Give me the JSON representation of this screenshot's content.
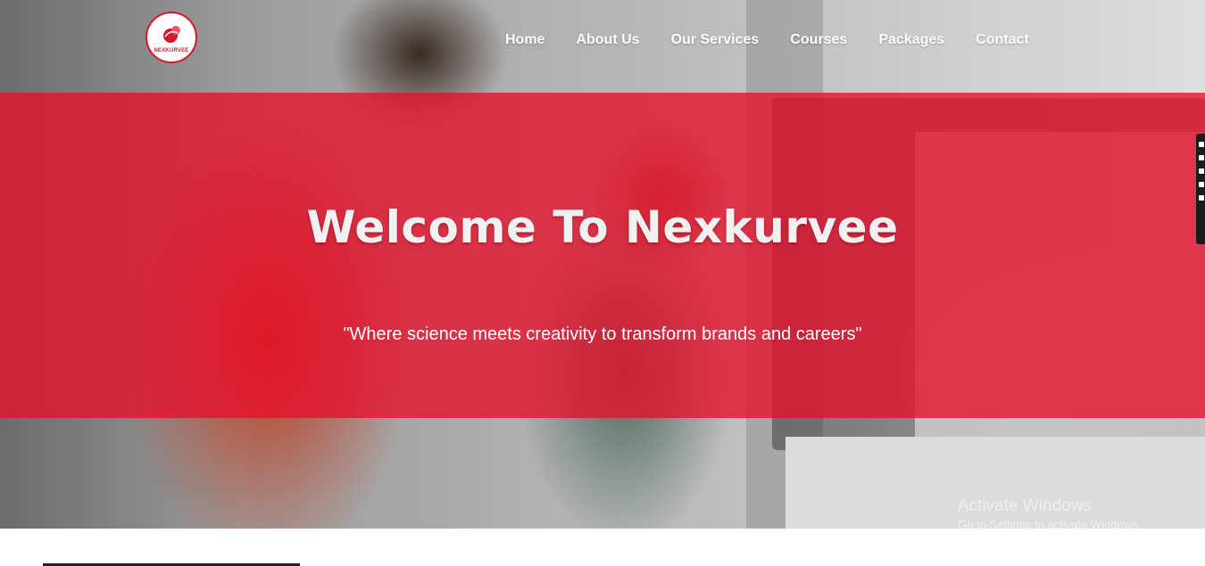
{
  "logo": {
    "text": "NEXKURVEE"
  },
  "nav": {
    "items": [
      {
        "label": "Home"
      },
      {
        "label": "About Us"
      },
      {
        "label": "Our Services"
      },
      {
        "label": "Courses"
      },
      {
        "label": "Packages"
      },
      {
        "label": "Contact"
      }
    ]
  },
  "hero": {
    "title": "Welcome To Nexkurvee",
    "tagline": "\"Where science meets creativity to transform brands and careers\""
  },
  "watermark": {
    "title": "Activate Windows",
    "subtitle": "Go to Settings to activate Windows."
  },
  "colors": {
    "brand_red": "#e5102c",
    "nav_text": "#ffffff"
  }
}
